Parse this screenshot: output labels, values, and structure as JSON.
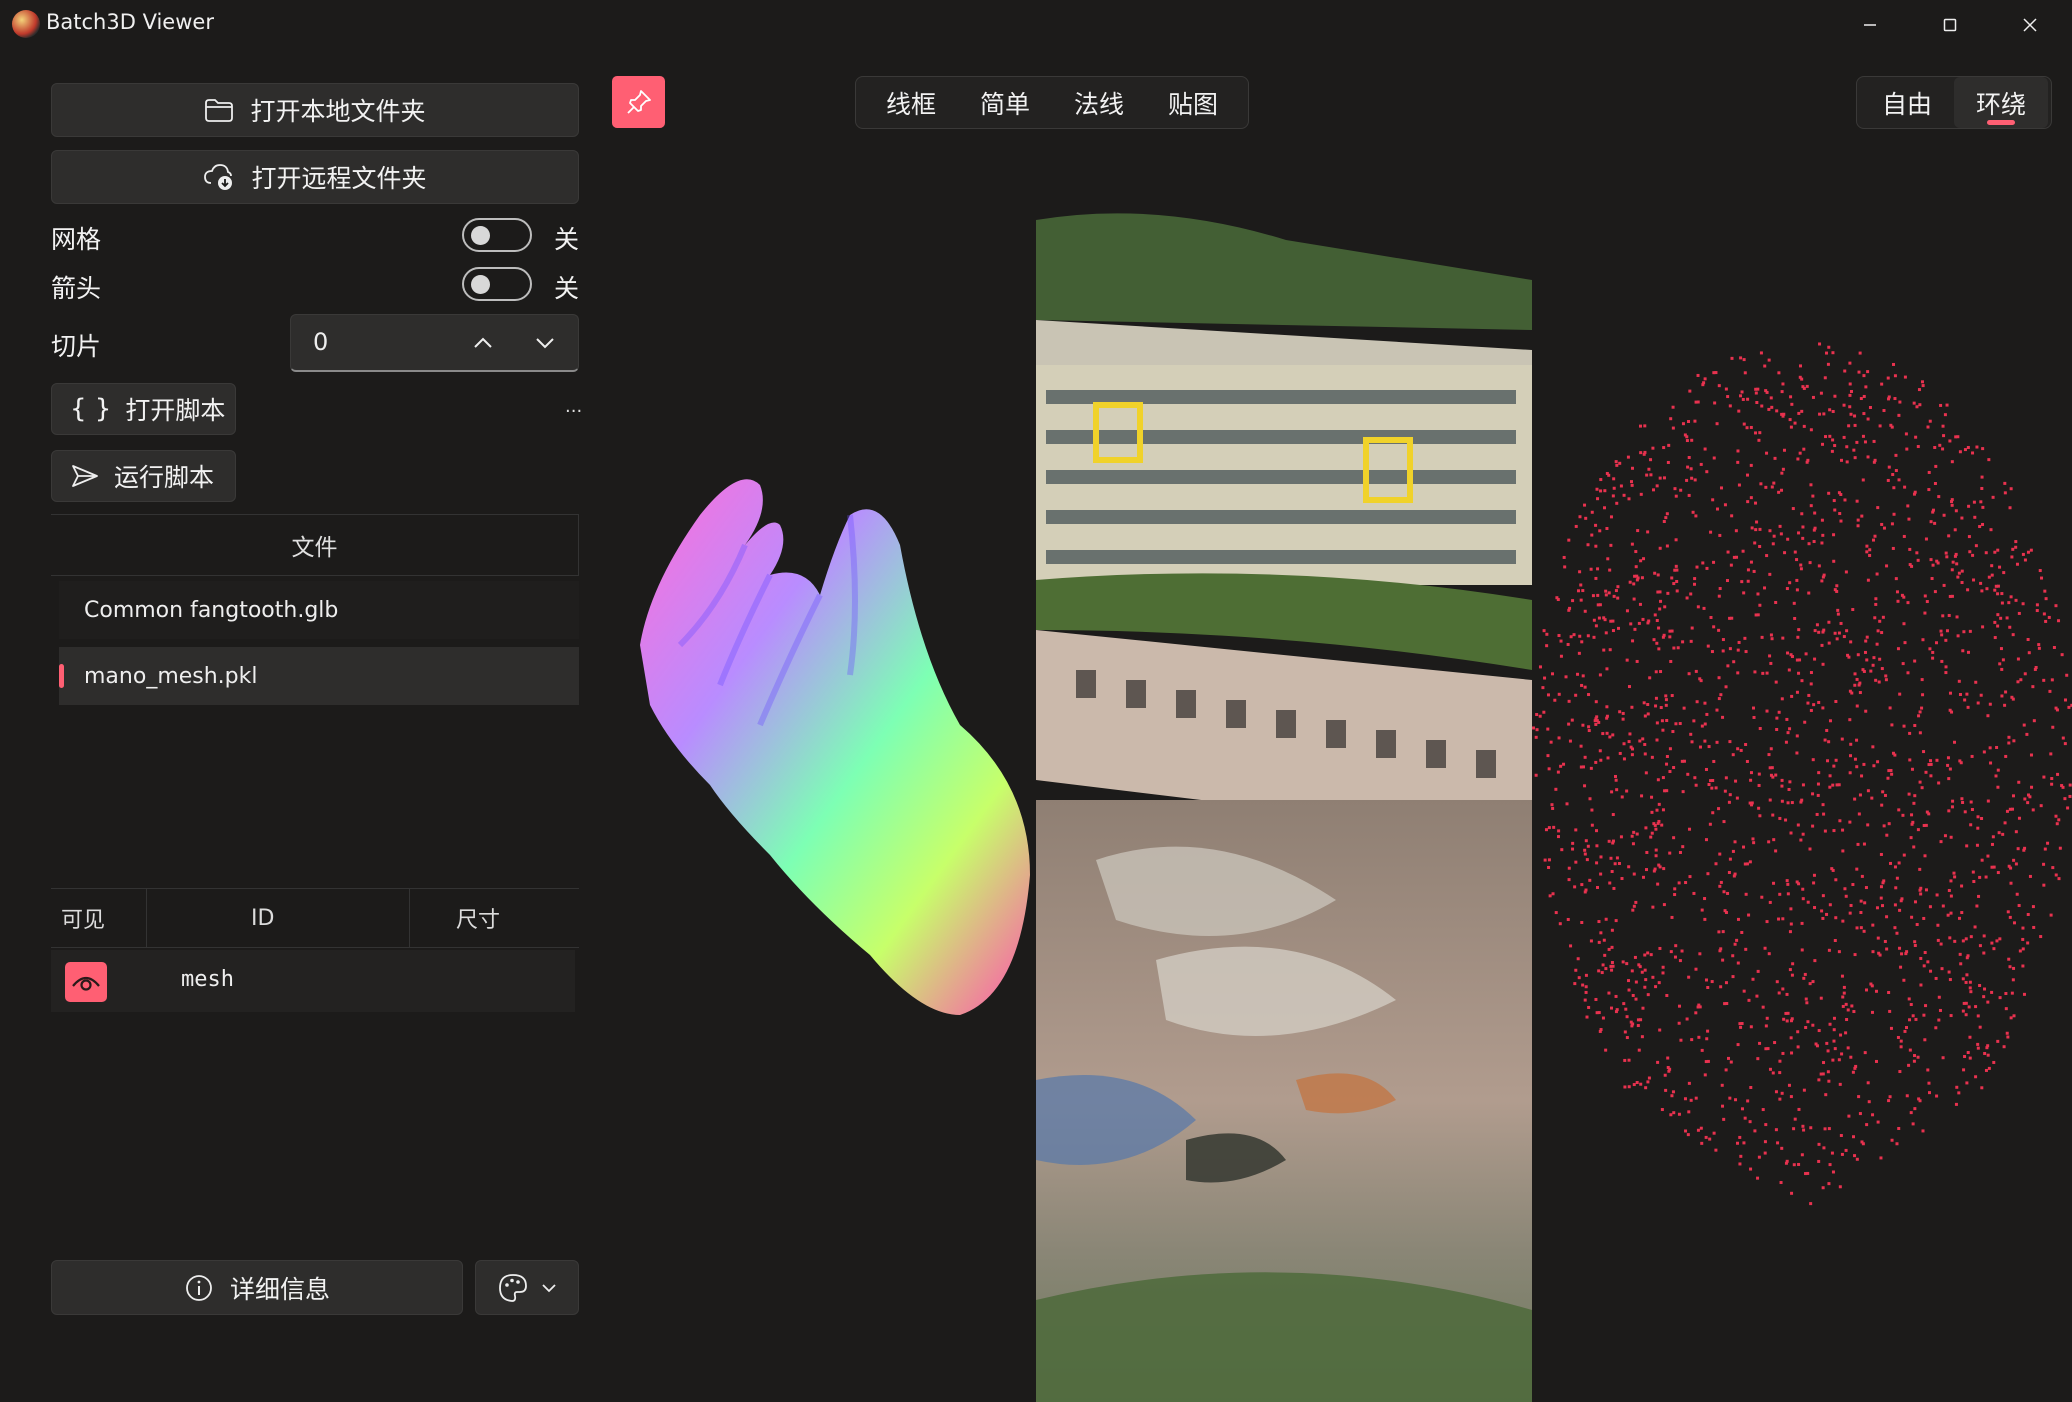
{
  "window": {
    "title": "Batch3D Viewer"
  },
  "sidebar": {
    "open_local_label": "打开本地文件夹",
    "open_remote_label": "打开远程文件夹",
    "grid": {
      "label": "网格",
      "state_label": "关",
      "on": false
    },
    "arrow": {
      "label": "箭头",
      "state_label": "关",
      "on": false
    },
    "slice": {
      "label": "切片",
      "value": "0"
    },
    "open_script_label": "打开脚本",
    "script_path": "...",
    "run_script_label": "运行脚本",
    "files_header": "文件",
    "files": [
      {
        "name": "Common fangtooth.glb",
        "selected": false
      },
      {
        "name": "mano_mesh.pkl",
        "selected": true
      }
    ],
    "table": {
      "columns": [
        "可见",
        "ID",
        "尺寸"
      ],
      "rows": [
        {
          "id": "mesh",
          "size": "",
          "visible": true
        }
      ]
    },
    "details_label": "详细信息"
  },
  "viewport": {
    "render_modes": [
      "线框",
      "简单",
      "法线",
      "贴图"
    ],
    "camera_modes": [
      "自由",
      "环绕"
    ],
    "active_camera": "环绕"
  },
  "colors": {
    "accent": "#ff5f73",
    "background": "#1c1b1a",
    "panel": "#2e2d2c",
    "point_cloud": "#e8324f"
  },
  "icons": [
    "app-icon",
    "folder-icon",
    "cloud-download-icon",
    "braces-icon",
    "send-icon",
    "pin-icon",
    "eye-icon",
    "info-icon",
    "palette-icon",
    "chevron-down-icon",
    "chevron-up-icon",
    "minimize-icon",
    "maximize-icon",
    "close-icon"
  ]
}
